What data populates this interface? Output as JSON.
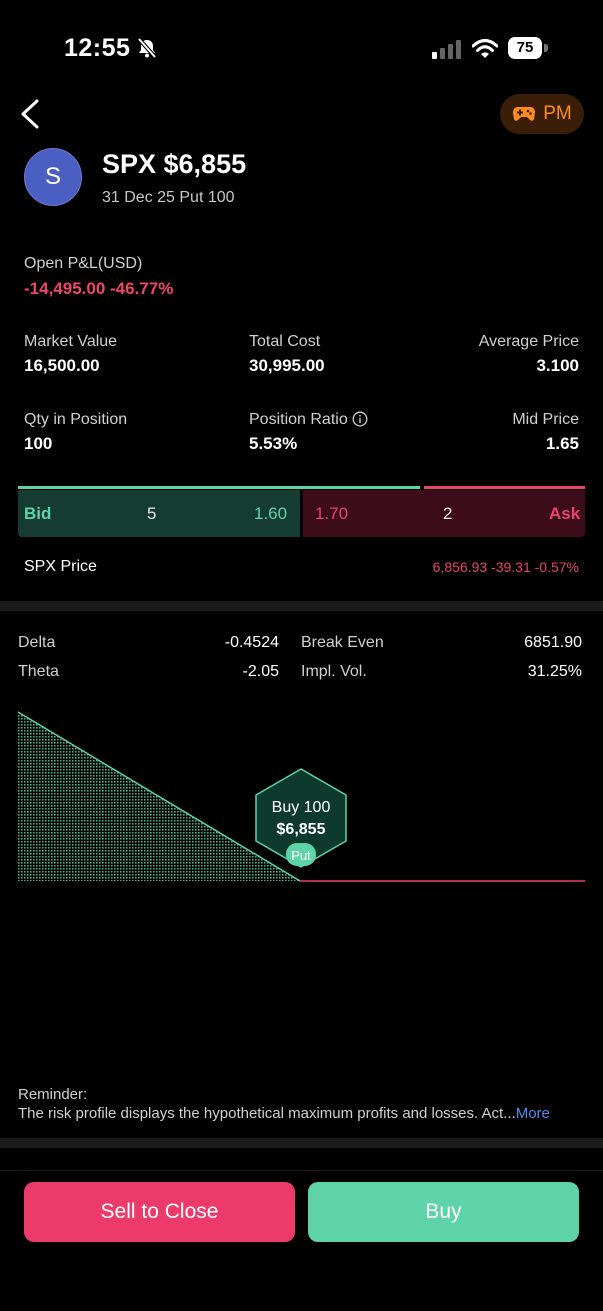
{
  "status_bar": {
    "time": "12:55",
    "battery": "75"
  },
  "header": {
    "pm_label": "PM",
    "avatar_letter": "S",
    "title": "SPX $6,855",
    "subtitle": "31 Dec 25 Put 100"
  },
  "pnl": {
    "label": "Open P&L(USD)",
    "value": "-14,495.00 -46.77%"
  },
  "stats": {
    "market_value": {
      "label": "Market Value",
      "value": "16,500.00"
    },
    "total_cost": {
      "label": "Total Cost",
      "value": "30,995.00"
    },
    "average_price": {
      "label": "Average Price",
      "value": "3.100"
    },
    "qty": {
      "label": "Qty in Position",
      "value": "100"
    },
    "position_ratio": {
      "label": "Position Ratio",
      "value": "5.53%"
    },
    "mid_price": {
      "label": "Mid Price",
      "value": "1.65"
    }
  },
  "quote": {
    "bid_label": "Bid",
    "bid_size": "5",
    "bid_price": "1.60",
    "ask_price": "1.70",
    "ask_size": "2",
    "ask_label": "Ask"
  },
  "underlying": {
    "label": "SPX Price",
    "value": "6,856.93 -39.31 -0.57%"
  },
  "greeks": {
    "delta": {
      "label": "Delta",
      "value": "-0.4524"
    },
    "theta": {
      "label": "Theta",
      "value": "-2.05"
    },
    "break_even": {
      "label": "Break Even",
      "value": "6851.90"
    },
    "impl_vol": {
      "label": "Impl. Vol.",
      "value": "31.25%"
    }
  },
  "risk_profile": {
    "line1": "Buy 100",
    "line2": "$6,855",
    "tag": "Put"
  },
  "reminder": {
    "title": "Reminder:",
    "text": "The risk profile displays the hypothetical maximum profits and losses. Act...",
    "more": "More"
  },
  "actions": {
    "sell_label": "Sell to Close",
    "buy_label": "Buy"
  },
  "colors": {
    "green": "#5fd3a8",
    "red": "#f0466a",
    "orange": "#ff8a1d",
    "link": "#4a8ef0"
  }
}
